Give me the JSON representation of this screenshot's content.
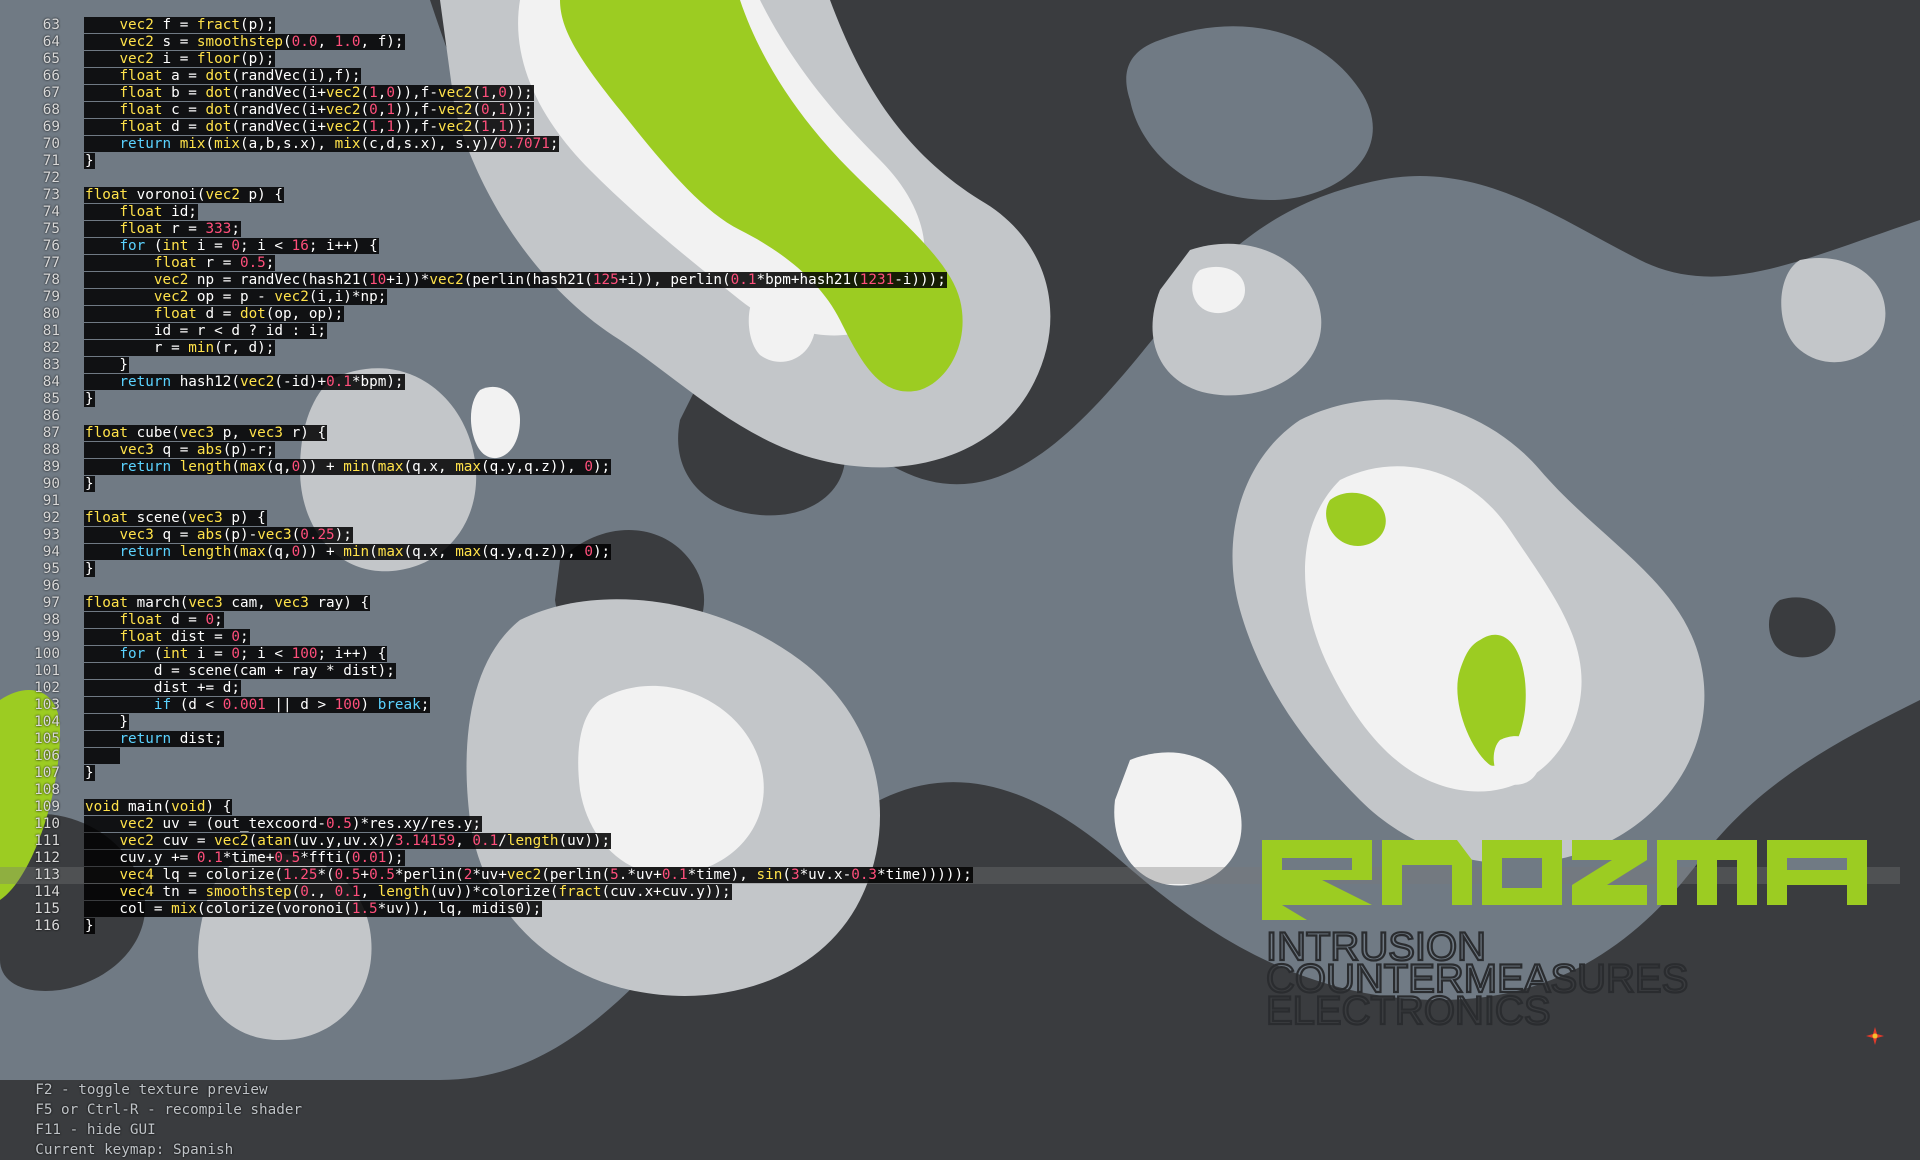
{
  "colors": {
    "background_dark": "#3a3c3f",
    "mid_gray": "#707a84",
    "light_gray": "#c3c6c9",
    "white": "#f2f2f2",
    "accent_green": "#9ccc22",
    "keyword": "#ffe24a",
    "number": "#ff4f7b",
    "flow": "#5bd3ff"
  },
  "editor": {
    "current_line": 113,
    "lines": [
      {
        "num": "63",
        "code": "    vec2 f = fract(p);"
      },
      {
        "num": "64",
        "code": "    vec2 s = smoothstep(0.0, 1.0, f);"
      },
      {
        "num": "65",
        "code": "    vec2 i = floor(p);"
      },
      {
        "num": "66",
        "code": "    float a = dot(randVec(i),f);"
      },
      {
        "num": "67",
        "code": "    float b = dot(randVec(i+vec2(1,0)),f-vec2(1,0));"
      },
      {
        "num": "68",
        "code": "    float c = dot(randVec(i+vec2(0,1)),f-vec2(0,1));"
      },
      {
        "num": "69",
        "code": "    float d = dot(randVec(i+vec2(1,1)),f-vec2(1,1));"
      },
      {
        "num": "70",
        "code": "    return mix(mix(a,b,s.x), mix(c,d,s.x), s.y)/0.7071;"
      },
      {
        "num": "71",
        "code": "}"
      },
      {
        "num": "72",
        "code": ""
      },
      {
        "num": "73",
        "code": "float voronoi(vec2 p) {"
      },
      {
        "num": "74",
        "code": "    float id;"
      },
      {
        "num": "75",
        "code": "    float r = 333;"
      },
      {
        "num": "76",
        "code": "    for (int i = 0; i < 16; i++) {"
      },
      {
        "num": "77",
        "code": "        float r = 0.5;"
      },
      {
        "num": "78",
        "code": "        vec2 np = randVec(hash21(10+i))*vec2(perlin(hash21(125+i)), perlin(0.1*bpm+hash21(1231-i)));"
      },
      {
        "num": "79",
        "code": "        vec2 op = p - vec2(i,i)*np;"
      },
      {
        "num": "80",
        "code": "        float d = dot(op, op);"
      },
      {
        "num": "81",
        "code": "        id = r < d ? id : i;"
      },
      {
        "num": "82",
        "code": "        r = min(r, d);"
      },
      {
        "num": "83",
        "code": "    }"
      },
      {
        "num": "84",
        "code": "    return hash12(vec2(-id)+0.1*bpm);"
      },
      {
        "num": "85",
        "code": "}"
      },
      {
        "num": "86",
        "code": ""
      },
      {
        "num": "87",
        "code": "float cube(vec3 p, vec3 r) {"
      },
      {
        "num": "88",
        "code": "    vec3 q = abs(p)-r;"
      },
      {
        "num": "89",
        "code": "    return length(max(q,0)) + min(max(q.x, max(q.y,q.z)), 0);"
      },
      {
        "num": "90",
        "code": "}"
      },
      {
        "num": "91",
        "code": ""
      },
      {
        "num": "92",
        "code": "float scene(vec3 p) {"
      },
      {
        "num": "93",
        "code": "    vec3 q = abs(p)-vec3(0.25);"
      },
      {
        "num": "94",
        "code": "    return length(max(q,0)) + min(max(q.x, max(q.y,q.z)), 0);"
      },
      {
        "num": "95",
        "code": "}"
      },
      {
        "num": "96",
        "code": ""
      },
      {
        "num": "97",
        "code": "float march(vec3 cam, vec3 ray) {"
      },
      {
        "num": "98",
        "code": "    float d = 0;"
      },
      {
        "num": "99",
        "code": "    float dist = 0;"
      },
      {
        "num": "100",
        "code": "    for (int i = 0; i < 100; i++) {"
      },
      {
        "num": "101",
        "code": "        d = scene(cam + ray * dist);"
      },
      {
        "num": "102",
        "code": "        dist += d;"
      },
      {
        "num": "103",
        "code": "        if (d < 0.001 || d > 100) break;"
      },
      {
        "num": "104",
        "code": "    }"
      },
      {
        "num": "105",
        "code": "    return dist;"
      },
      {
        "num": "106",
        "code": "    "
      },
      {
        "num": "107",
        "code": "}"
      },
      {
        "num": "108",
        "code": ""
      },
      {
        "num": "109",
        "code": "void main(void) {"
      },
      {
        "num": "110",
        "code": "    vec2 uv = (out_texcoord-0.5)*res.xy/res.y;"
      },
      {
        "num": "111",
        "code": "    vec2 cuv = vec2(atan(uv.y,uv.x)/3.14159, 0.1/length(uv));"
      },
      {
        "num": "112",
        "code": "    cuv.y += 0.1*time+0.5*ffti(0.01);"
      },
      {
        "num": "113",
        "code": "    vec4 lq = colorize(1.25*(0.5+0.5*perlin(2*uv+vec2(perlin(5.*uv+0.1*time), sin(3*uv.x-0.3*time)))));"
      },
      {
        "num": "114",
        "code": "    vec4 tn = smoothstep(0., 0.1, length(uv))*colorize(fract(cuv.x+cuv.y));"
      },
      {
        "num": "115",
        "code": "    col = mix(colorize(voronoi(1.5*uv)), lq, midis0);"
      },
      {
        "num": "116",
        "code": "}"
      }
    ]
  },
  "logo": {
    "wordmark": "QNQZMQ",
    "tagline_lines": [
      "INTRUSION",
      "COUNTERMEASURES",
      "ELECTRONICS"
    ]
  },
  "status_bar": [
    "F2 - toggle texture preview",
    "F5 or Ctrl-R - recompile shader",
    "F11 - hide GUI",
    "Current keymap: Spanish"
  ],
  "icons": {
    "corner": "bonzomatic-app-icon"
  }
}
